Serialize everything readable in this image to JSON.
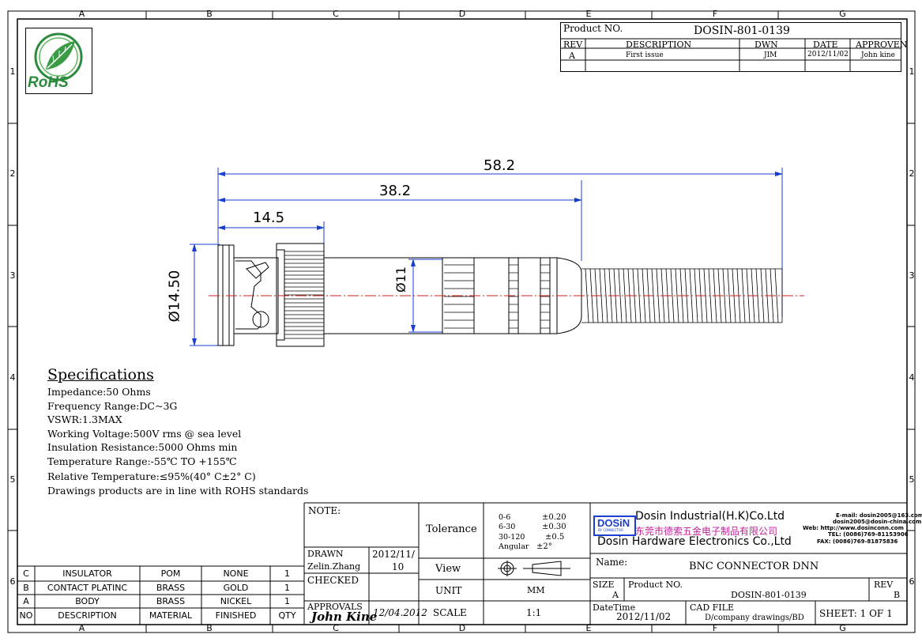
{
  "grid": {
    "cols": [
      "A",
      "B",
      "C",
      "D",
      "E",
      "F",
      "G"
    ],
    "rows": [
      "1",
      "2",
      "3",
      "4",
      "5",
      "6"
    ]
  },
  "logo": {
    "text": "RoHS"
  },
  "revision": {
    "product_label": "Product NO.",
    "product_no": "DOSIN-801-0139",
    "headers": {
      "rev": "REV",
      "desc": "DESCRIPTION",
      "dwn": "DWN",
      "date": "DATE",
      "approven": "APPROVEN"
    },
    "row": {
      "rev": "A",
      "desc": "First issue",
      "dwn": "JIM",
      "date": "2012/11/02",
      "approven": "John kine"
    }
  },
  "dimensions": {
    "overall": "58.2",
    "middle": "38.2",
    "short": "14.5",
    "dia_large": "Ø14.50",
    "dia_small": "Ø11"
  },
  "specs": {
    "title": "Specifications",
    "lines": [
      "Impedance:50 Ohms",
      "Frequency Range:DC~3G",
      "VSWR:1.3MAX",
      "Working Voltage:500V rms @ sea level",
      "Insulation Resistance:5000 Ohms min",
      "Temperature Range:-55℃ TO +155℃",
      "Relative Temperature:≤95%(40° C±2° C)",
      "Drawings products are in line with ROHS standards"
    ]
  },
  "bom": {
    "rows": [
      {
        "no": "C",
        "desc": "INSULATOR",
        "material": "POM",
        "finished": "NONE",
        "qty": "1"
      },
      {
        "no": "B",
        "desc": "CONTACT PLATINC",
        "material": "BRASS",
        "finished": "GOLD",
        "qty": "1"
      },
      {
        "no": "A",
        "desc": "BODY",
        "material": "BRASS",
        "finished": "NICKEL",
        "qty": "1"
      }
    ],
    "header": {
      "no": "NO",
      "desc": "DESCRIPTION",
      "material": "MATERIAL",
      "finished": "FINISHED",
      "qty": "QTY"
    }
  },
  "title_block": {
    "note": "NOTE:",
    "drawn_label": "DRAWN",
    "drawn_name": "Zelin.Zhang",
    "drawn_date_1": "2012/11/",
    "drawn_date_2": "10",
    "checked": "CHECKED",
    "approvals": "APPROVALS",
    "approvals_sig": "John Kine",
    "approvals_date": "12/04.2012",
    "tolerance_label": "Tolerance",
    "tolerances": [
      {
        "range": "0-6",
        "tol": "±0.20"
      },
      {
        "range": "6-30",
        "tol": "±0.30"
      },
      {
        "range": "30-120",
        "tol": "±0.5"
      },
      {
        "range": "Angular",
        "tol": "±2°"
      }
    ],
    "view_label": "View",
    "unit_label": "UNIT",
    "unit_value": "MM",
    "scale_label": "SCALE",
    "scale_value": "1:1",
    "company": {
      "logo": "DOSiN",
      "logo_sub": "BY CONNECTOR",
      "name_en1": "Dosin Industrial(H.K)Co.Ltd",
      "name_cn": "东莞市德索五金电子制品有限公司",
      "name_en2": "Dosin Hardware Electronics Co.,Ltd",
      "email1": "E-mail: dosin2005@163.com",
      "email2": "dosin2005@dosin-china.com",
      "web": "Web: http://www.dosinconn.com",
      "tel": "TEL: (0086)769-81153906",
      "fax": "FAX: (0086)769-81875836"
    },
    "name_label": "Name:",
    "name_value": "BNC CONNECTOR DNN",
    "size_label": "SIZE",
    "size_value": "A",
    "product_label": "Product NO.",
    "product_value": "DOSIN-801-0139",
    "rev_label": "REV",
    "rev_value": "B",
    "datetime_label": "DateTime",
    "datetime_value": "2012/11/02",
    "cad_label": "CAD FILE",
    "cad_value": "D/company drawings/BD",
    "sheet": "SHEET: 1 OF 1"
  }
}
